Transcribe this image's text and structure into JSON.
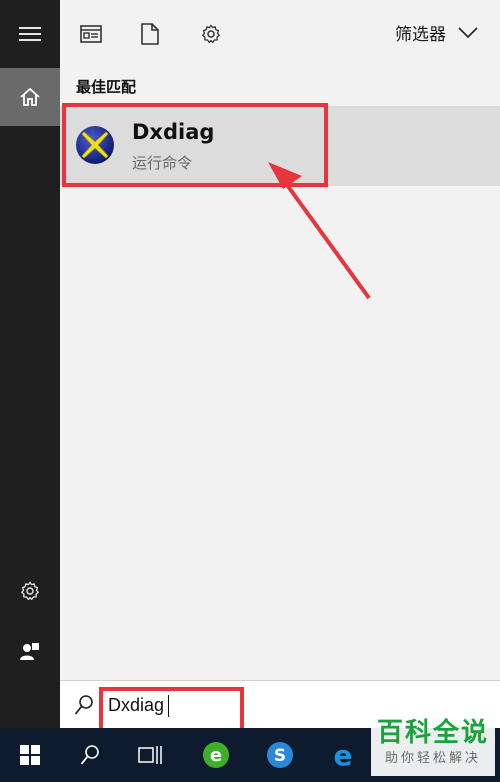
{
  "rail": {
    "menu_icon": "hamburger-icon",
    "home_icon": "home-icon",
    "settings_icon": "gear-icon",
    "user_icon": "user-icon"
  },
  "toolbar": {
    "icons": [
      "document-view-icon",
      "file-icon",
      "gear-icon"
    ],
    "filter_label": "筛选器",
    "filter_icon": "chevron-down-icon"
  },
  "results": {
    "section_title": "最佳匹配",
    "items": [
      {
        "name": "Dxdiag",
        "subtitle": "运行命令",
        "icon": "directx-icon"
      }
    ]
  },
  "search": {
    "value": "Dxdiag",
    "icon": "search-icon"
  },
  "taskbar": {
    "icons": [
      "windows-start-icon",
      "search-icon",
      "task-view-icon",
      "360-browser-icon",
      "sogou-browser-icon",
      "edge-icon"
    ]
  },
  "watermark": {
    "title": "百科全说",
    "subtitle": "助你轻松解决"
  },
  "colors": {
    "rail_bg": "#1f1f1f",
    "panel_bg": "#f2f2f2",
    "selected_bg": "#dcdcdc",
    "highlight_red": "#e8343b",
    "taskbar_bg": "#0e1a2d",
    "watermark_green": "#1aa33a"
  }
}
